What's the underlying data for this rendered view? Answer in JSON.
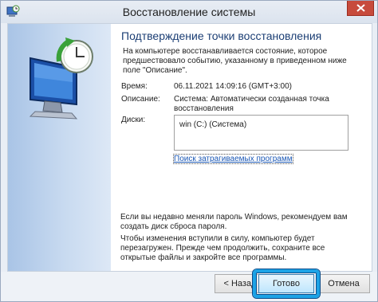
{
  "window": {
    "title": "Восстановление системы",
    "icons": {
      "app": "system-restore-icon",
      "close": "close-icon"
    }
  },
  "main": {
    "heading": "Подтверждение точки восстановления",
    "description": "На компьютере восстанавливается состояние, которое предшествовало событию, указанному в приведенном ниже поле \"Описание\".",
    "fields": {
      "time_label": "Время:",
      "time_value": "06.11.2021 14:09:16 (GMT+3:00)",
      "description_label": "Описание:",
      "description_value": "Система: Автоматически созданная точка восстановления",
      "disks_label": "Диски:",
      "disks": [
        "win (C:) (Система)"
      ]
    },
    "affected_programs_link": "Поиск затрагиваемых программ",
    "password_note": "Если вы недавно меняли пароль Windows, рекомендуем вам создать диск сброса пароля.",
    "restart_note": "Чтобы изменения вступили в силу, компьютер будет перезагружен. Прежде чем продолжить, сохраните все открытые файлы и закройте все программы."
  },
  "buttons": {
    "back": "< Назад",
    "finish": "Готово",
    "cancel": "Отмена"
  },
  "colors": {
    "heading": "#1b3e74",
    "link": "#1a57b5",
    "highlight": "#1ca3e6",
    "close_button": "#c74b3c"
  }
}
